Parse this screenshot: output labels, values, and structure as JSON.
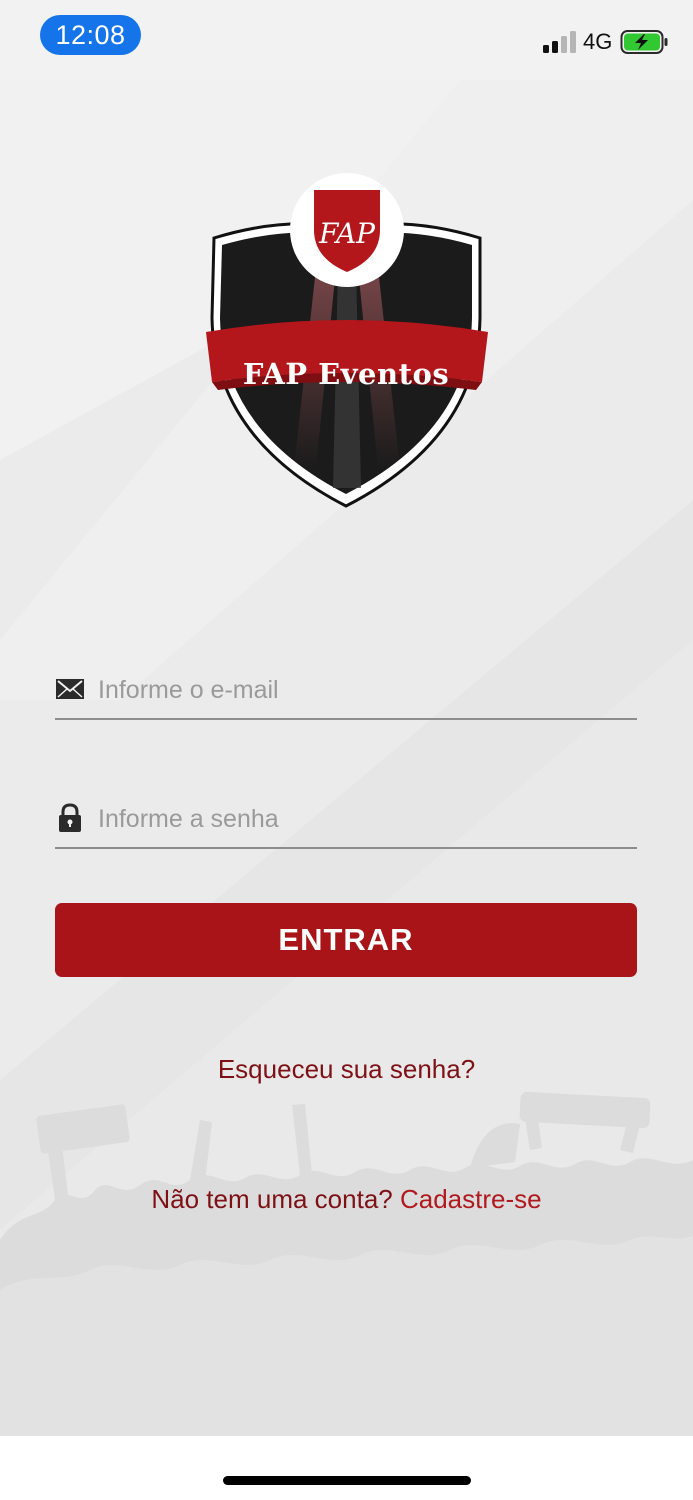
{
  "status_bar": {
    "time": "12:08",
    "network": "4G",
    "signal_bars_active": 2,
    "signal_bars_total": 4,
    "battery_charging": true,
    "battery_color": "#32c832"
  },
  "logo": {
    "text": "FAP Eventos",
    "monogram": "FAP",
    "brand_color": "#b3161b",
    "shield_color": "#1b1b1b"
  },
  "login": {
    "email_placeholder": "Informe o e-mail",
    "email_value": "",
    "email_icon": "envelope-icon",
    "password_placeholder": "Informe a senha",
    "password_value": "",
    "password_icon": "lock-icon",
    "submit_label": "ENTRAR",
    "accent_color": "#a81418"
  },
  "links": {
    "forgot_password": "Esqueceu sua senha?",
    "no_account": "Não tem uma conta?",
    "signup": "Cadastre-se"
  }
}
